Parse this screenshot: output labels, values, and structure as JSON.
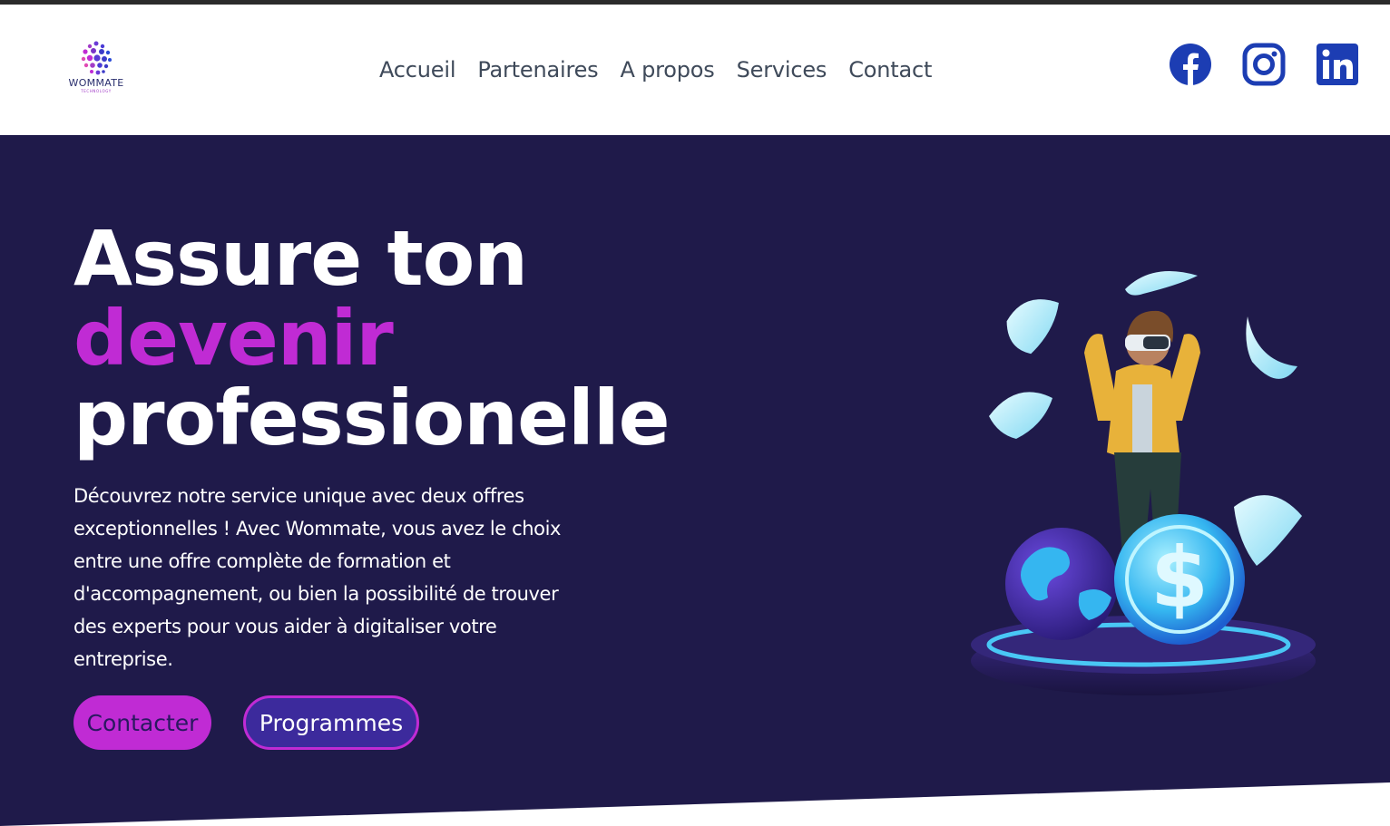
{
  "brand": {
    "name": "WOMMATE",
    "tagline": "TECHNOLOGY",
    "colors": {
      "primary": "#c02bd4",
      "navy": "#1f1a4a",
      "social": "#1c3db3",
      "button_secondary": "#3c2a9c"
    }
  },
  "nav": {
    "items": [
      {
        "label": "Accueil"
      },
      {
        "label": "Partenaires"
      },
      {
        "label": "A propos"
      },
      {
        "label": "Services"
      },
      {
        "label": "Contact"
      }
    ]
  },
  "social": [
    {
      "icon": "facebook-icon"
    },
    {
      "icon": "instagram-icon"
    },
    {
      "icon": "linkedin-icon"
    }
  ],
  "hero": {
    "line1": "Assure ton",
    "line2": "devenir",
    "line3": "professionelle",
    "description": "Découvrez notre service unique avec deux offres exceptionnelles ! Avec Wommate, vous avez le choix entre une offre complète de formation et d'accompagnement, ou bien la possibilité de trouver des experts pour vous aider à digitaliser votre entreprise.",
    "buttons": {
      "contact": "Contacter",
      "programs": "Programmes"
    },
    "illustration": "vr-woman-money-illustration"
  }
}
